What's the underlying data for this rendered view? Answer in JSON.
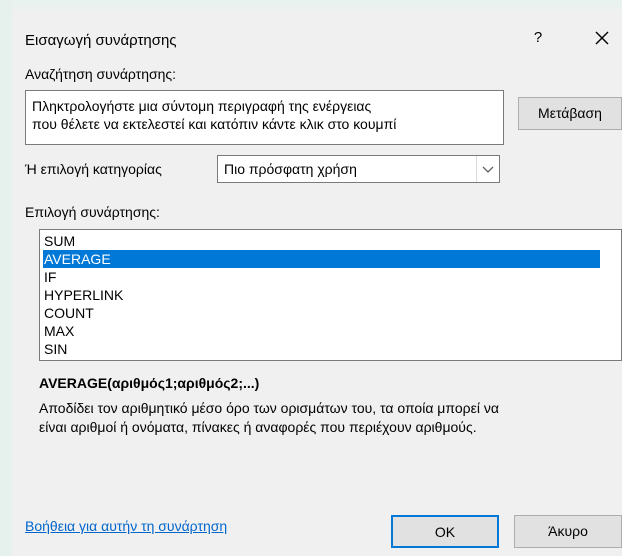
{
  "dialog": {
    "title": "Εισαγωγή συνάρτησης",
    "help_glyph": "?",
    "close_glyph": "✕"
  },
  "search": {
    "label": "Αναζήτηση συνάρτησης:",
    "text": "Πληκτρολογήστε μια σύντομη περιγραφή της ενέργειας\nπου θέλετε να εκτελεστεί και κατόπιν κάντε κλικ στο κουμπί",
    "go_button": "Μετάβαση"
  },
  "category": {
    "label": "Ή επιλογή κατηγορίας",
    "selected": "Πιο πρόσφατη χρήση"
  },
  "functions": {
    "label": "Επιλογή συνάρτησης:",
    "items": [
      "SUM",
      "AVERAGE",
      "IF",
      "HYPERLINK",
      "COUNT",
      "MAX",
      "SIN"
    ],
    "selected_index": 1
  },
  "detail": {
    "signature": "AVERAGE(αριθμός1;αριθμός2;...)",
    "description": "Αποδίδει τον αριθμητικό μέσο όρο των ορισμάτων του, τα οποία μπορεί να\nείναι αριθμοί ή ονόματα, πίνακες ή αναφορές που περιέχουν αριθμούς."
  },
  "footer": {
    "help_link": "Βοήθεια για αυτήν τη συνάρτηση",
    "ok": "OK",
    "cancel": "Άκυρο"
  },
  "colors": {
    "accent": "#0078d7",
    "link": "#0066cc",
    "dialog_bg": "#f0f0f0"
  }
}
